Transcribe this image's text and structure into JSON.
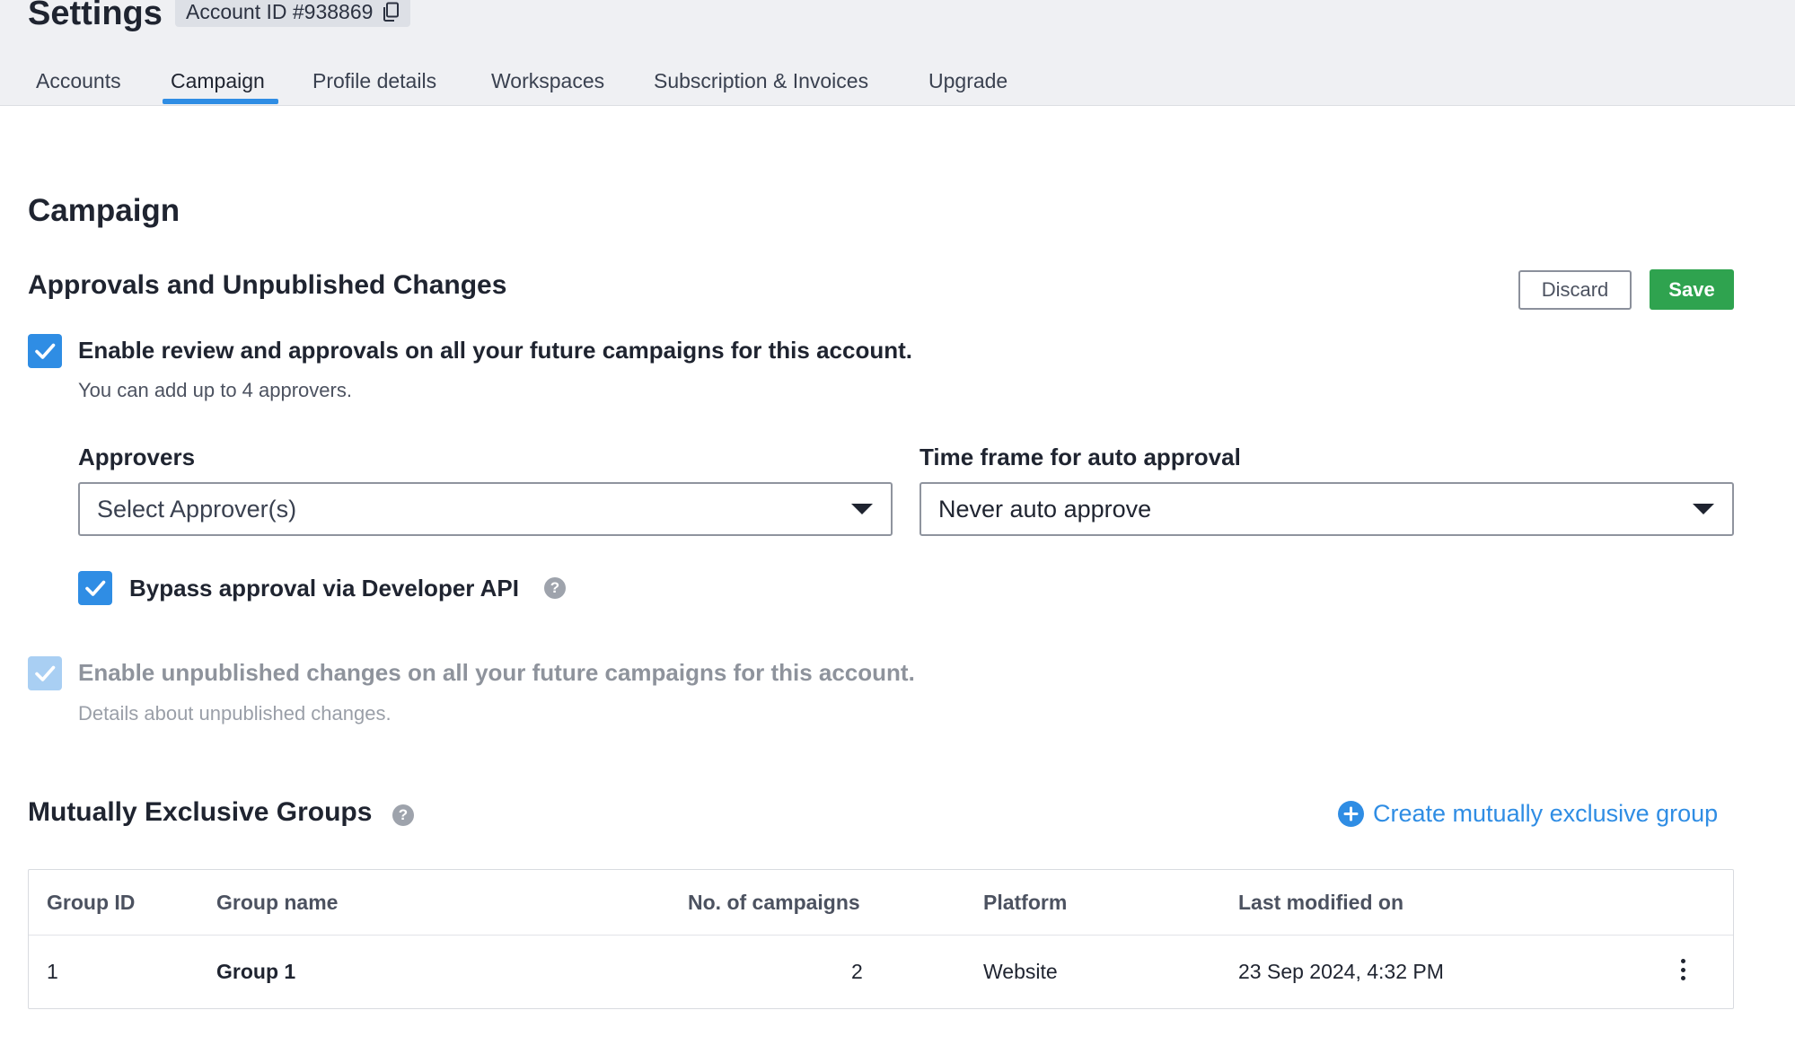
{
  "header": {
    "title": "Settings",
    "account_id": "Account ID #938869"
  },
  "tabs": [
    {
      "label": "Accounts",
      "active": false
    },
    {
      "label": "Campaign",
      "active": true
    },
    {
      "label": "Profile details",
      "active": false
    },
    {
      "label": "Workspaces",
      "active": false
    },
    {
      "label": "Subscription & Invoices",
      "active": false
    },
    {
      "label": "Upgrade",
      "active": false
    }
  ],
  "page": {
    "heading": "Campaign"
  },
  "approvals": {
    "heading": "Approvals and Unpublished Changes",
    "discard_label": "Discard",
    "save_label": "Save",
    "enable_review": {
      "checked": true,
      "label": "Enable review and approvals on all your future campaigns for this account.",
      "hint": "You can add up to 4 approvers."
    },
    "approvers": {
      "label": "Approvers",
      "placeholder": "Select Approver(s)"
    },
    "time_frame": {
      "label": "Time frame for auto approval",
      "value": "Never auto approve"
    },
    "bypass": {
      "checked": true,
      "label": "Bypass approval via Developer API"
    },
    "unpublished": {
      "checked": true,
      "disabled": true,
      "label": "Enable unpublished changes on all your future campaigns for this account.",
      "hint": "Details about unpublished changes."
    }
  },
  "groups": {
    "heading": "Mutually Exclusive Groups",
    "create_label": "Create mutually exclusive group",
    "columns": [
      "Group ID",
      "Group name",
      "No. of campaigns",
      "Platform",
      "Last modified on"
    ],
    "rows": [
      {
        "id": "1",
        "name": "Group 1",
        "campaigns": "2",
        "platform": "Website",
        "modified": "23 Sep 2024, 4:32 PM"
      }
    ]
  },
  "colors": {
    "accent": "#2f8de4",
    "save": "#2fa34f",
    "header_bg": "#eff0f3"
  }
}
